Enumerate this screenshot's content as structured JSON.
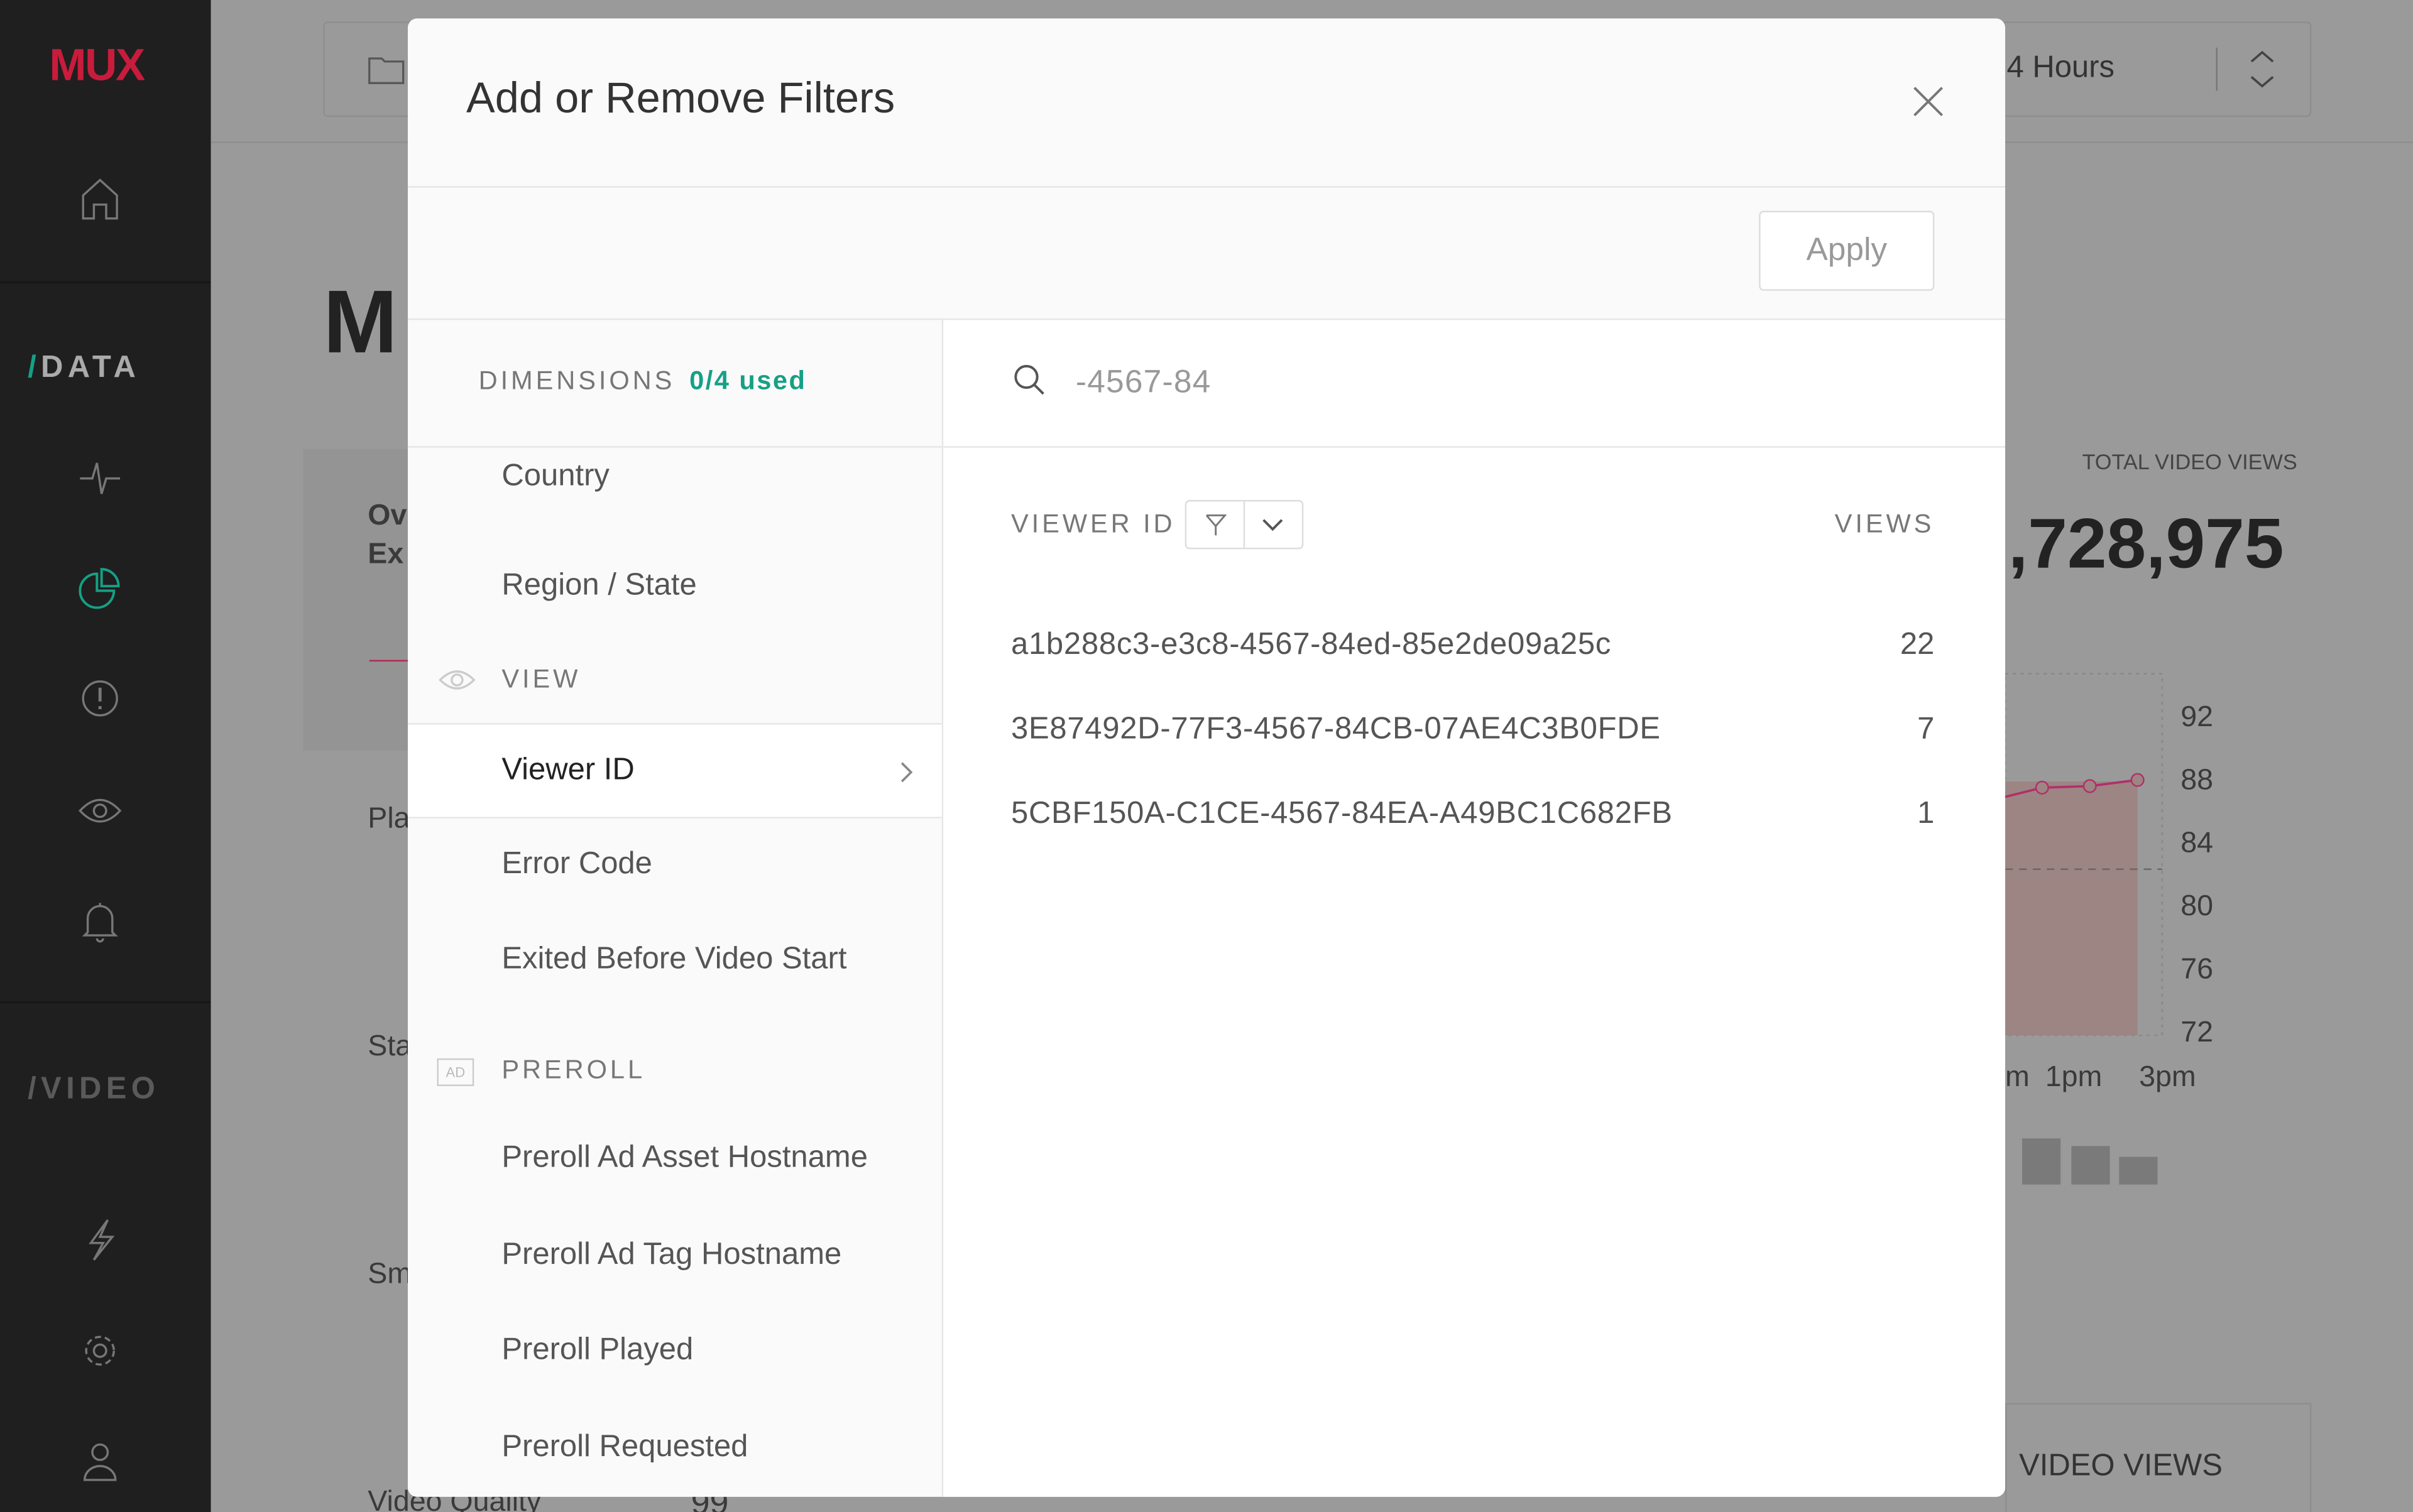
{
  "brand": {
    "logo": "MUX",
    "logo_color": "#d6204f"
  },
  "sidebar": {
    "sections": [
      {
        "slash": "/",
        "label": "DATA"
      },
      {
        "slash": "/",
        "label": "VIDEO"
      }
    ],
    "icons": [
      "home-icon",
      "pulse-icon",
      "pie-chart-icon",
      "alert-icon",
      "eye-icon",
      "bell-icon",
      "lightning-icon",
      "gear-icon",
      "user-icon"
    ],
    "accent": "#16a085"
  },
  "background": {
    "time_range": "4 Hours",
    "title_fragment": "M",
    "card_fragments": [
      "Ov",
      "Ex",
      "Pla",
      "Sta",
      "Sm"
    ],
    "bottom_fragments": [
      "Video Quality",
      "99"
    ],
    "total_label": "TOTAL VIDEO VIEWS",
    "total_value_visible": ",728,975",
    "axis_y": [
      "92",
      "88",
      "84",
      "80",
      "76",
      "72"
    ],
    "axis_x": [
      "m",
      "1pm",
      "3pm"
    ],
    "video_views_label": "VIDEO VIEWS"
  },
  "modal": {
    "title": "Add or Remove Filters",
    "apply_label": "Apply",
    "dimensions_label": "DIMENSIONS",
    "dimensions_used": "0/4 used",
    "items_top": [
      "Country",
      "Region / State"
    ],
    "view_section": "VIEW",
    "view_items": [
      "Viewer ID",
      "Error Code",
      "Exited Before Video Start"
    ],
    "preroll_section": "PREROLL",
    "preroll_badge": "AD",
    "preroll_items": [
      "Preroll Ad Asset Hostname",
      "Preroll Ad Tag Hostname",
      "Preroll Played",
      "Preroll Requested"
    ],
    "selected": "Viewer ID",
    "search_value": "-4567-84",
    "column_name": "VIEWER ID",
    "column_views": "VIEWS",
    "rows": [
      {
        "id": "a1b288c3-e3c8-4567-84ed-85e2de09a25c",
        "views": "22"
      },
      {
        "id": "3E87492D-77F3-4567-84CB-07AE4C3B0FDE",
        "views": "7"
      },
      {
        "id": "5CBF150A-C1CE-4567-84EA-A49BC1C682FB",
        "views": "1"
      }
    ]
  }
}
